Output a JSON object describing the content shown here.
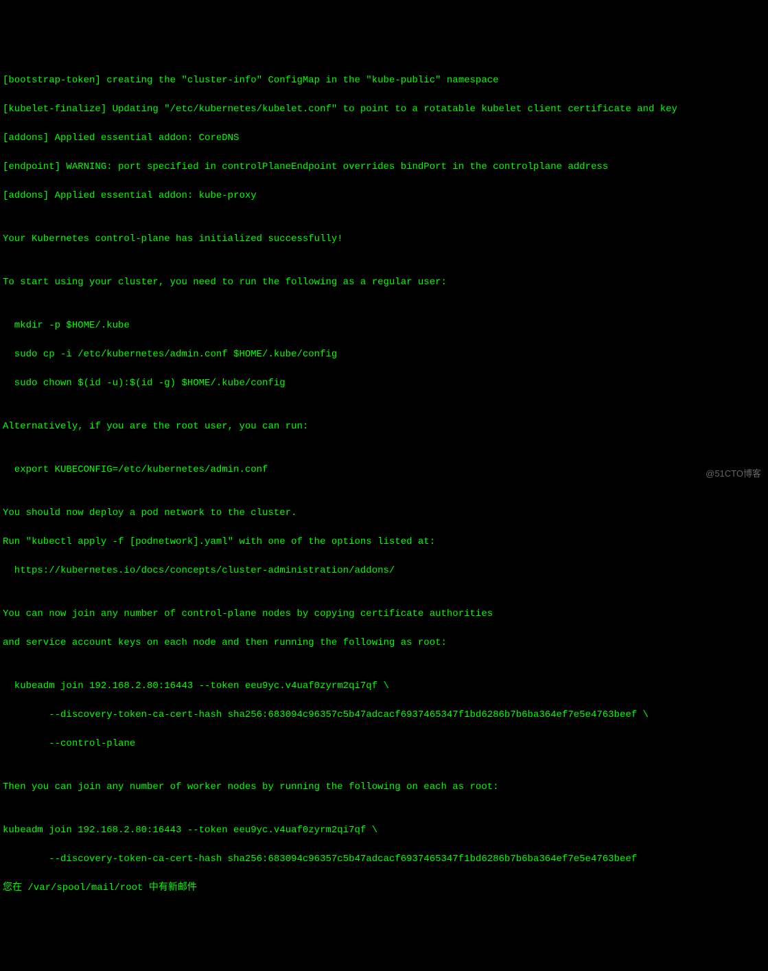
{
  "lines": {
    "l0": "[bootstrap-token] creating the \"cluster-info\" ConfigMap in the \"kube-public\" namespace",
    "l1": "[kubelet-finalize] Updating \"/etc/kubernetes/kubelet.conf\" to point to a rotatable kubelet client certificate and key",
    "l2": "[addons] Applied essential addon: CoreDNS",
    "l3": "[endpoint] WARNING: port specified in controlPlaneEndpoint overrides bindPort in the controlplane address",
    "l4": "[addons] Applied essential addon: kube-proxy",
    "l5": "",
    "l6": "Your Kubernetes control-plane has initialized successfully!",
    "l7": "",
    "l8": "To start using your cluster, you need to run the following as a regular user:",
    "l9": "",
    "l10": "  mkdir -p $HOME/.kube",
    "l11": "  sudo cp -i /etc/kubernetes/admin.conf $HOME/.kube/config",
    "l12": "  sudo chown $(id -u):$(id -g) $HOME/.kube/config",
    "l13": "",
    "l14": "Alternatively, if you are the root user, you can run:",
    "l15": "",
    "l16": "  export KUBECONFIG=/etc/kubernetes/admin.conf",
    "l17": "",
    "l18": "You should now deploy a pod network to the cluster.",
    "l19": "Run \"kubectl apply -f [podnetwork].yaml\" with one of the options listed at:",
    "l20": "  https://kubernetes.io/docs/concepts/cluster-administration/addons/",
    "l21": "",
    "l22": "You can now join any number of control-plane nodes by copying certificate authorities",
    "l23": "and service account keys on each node and then running the following as root:",
    "l24": "",
    "l25": "  kubeadm join 192.168.2.80:16443 --token eeu9yc.v4uaf0zyrm2qi7qf \\",
    "l26": "        --discovery-token-ca-cert-hash sha256:683094c96357c5b47adcacf6937465347f1bd6286b7b6ba364ef7e5e4763beef \\",
    "l27": "        --control-plane ",
    "l28": "",
    "l29": "Then you can join any number of worker nodes by running the following on each as root:",
    "l30": "",
    "l31": "kubeadm join 192.168.2.80:16443 --token eeu9yc.v4uaf0zyrm2qi7qf \\",
    "l32": "        --discovery-token-ca-cert-hash sha256:683094c96357c5b47adcacf6937465347f1bd6286b7b6ba364ef7e5e4763beef ",
    "l33": "您在 /var/spool/mail/root 中有新邮件"
  },
  "watermark": "@51CTO博客"
}
